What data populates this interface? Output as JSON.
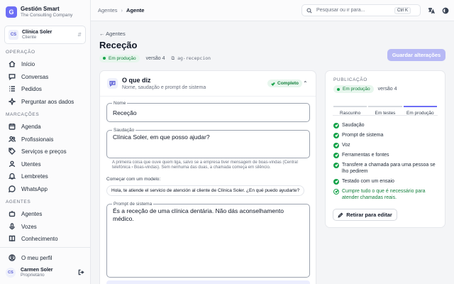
{
  "brand": {
    "initial": "G",
    "title": "Gestión Smart",
    "subtitle": "The Consulting Company"
  },
  "tenant": {
    "initials": "CS",
    "name": "Clínica Soler",
    "role": "Cliente"
  },
  "sidebar": {
    "sections": [
      "Operação",
      "Marcações",
      "Agentes"
    ],
    "items": [
      {
        "label": "Início",
        "icon": "home-icon"
      },
      {
        "label": "Conversas",
        "icon": "chat-icon"
      },
      {
        "label": "Pedidos",
        "icon": "list-icon"
      },
      {
        "label": "Perguntar aos dados",
        "icon": "sparkle-icon"
      },
      {
        "label": "Agenda",
        "icon": "calendar-icon"
      },
      {
        "label": "Profissionais",
        "icon": "users-icon"
      },
      {
        "label": "Serviços e preços",
        "icon": "tag-icon"
      },
      {
        "label": "Utentes",
        "icon": "person-icon"
      },
      {
        "label": "Lembretes",
        "icon": "bell-icon"
      },
      {
        "label": "WhatsApp",
        "icon": "whatsapp-icon"
      },
      {
        "label": "Agentes",
        "icon": "bot-icon"
      },
      {
        "label": "Vozes",
        "icon": "mic-icon"
      },
      {
        "label": "Conhecimento",
        "icon": "book-icon"
      }
    ],
    "profile_label": "O meu perfil",
    "user": {
      "initials": "CS",
      "name": "Carmen Soler",
      "role": "Proprietário"
    }
  },
  "topbar": {
    "breadcrumb": [
      "Agentes",
      "Agente"
    ],
    "search_placeholder": "Pesquisar ou ir para...",
    "shortcut": "Ctrl K"
  },
  "page": {
    "back_label": "Agentes",
    "title": "Receção",
    "status": "Em produção",
    "version": "versão 4",
    "slug": "ag-recepcion",
    "save_label": "Guardar alterações"
  },
  "section": {
    "title": "O que diz",
    "subtitle": "Nome, saudação e prompt de sistema",
    "status": "Completo",
    "name_label": "Nome",
    "name_value": "Receção",
    "greeting_label": "Saudação",
    "greeting_value": "Clínica Soler, em que posso ajudar?",
    "greeting_hint": "A primeira coisa que ouve quem liga, salvo se a empresa tiver mensagem de boas-vindas (Central telefónica › Boas-vindas). Sem nenhuma das duas, a chamada começa em silêncio.",
    "model_label": "Começar com um modelo:",
    "model_chip": "Hola, te atiende el servicio de atención al cliente de Clínica Soler. ¿En qué puedo ayudarte?",
    "prompt_label": "Prompt de sistema",
    "prompt_value": "És a receção de uma clínica dentária. Não dás aconselhamento médico."
  },
  "publication": {
    "label": "Publicação",
    "status": "Em produção",
    "version": "versão 4",
    "tabs": [
      "Rascunho",
      "Em testes",
      "Em produção"
    ],
    "active_tab": 2,
    "checks": [
      "Saudação",
      "Prompt de sistema",
      "Voz",
      "Ferramentas e fontes",
      "Transfere a chamada para uma pessoa se lho pedirem",
      "Testado com um ensaio"
    ],
    "note": "Cumpre tudo o que é necessário para atender chamadas reais.",
    "withdraw_label": "Retirar para editar"
  },
  "colors": {
    "accent": "#6d6ef5",
    "success": "#16a34a",
    "save_disabled": "#b7b9f5"
  }
}
